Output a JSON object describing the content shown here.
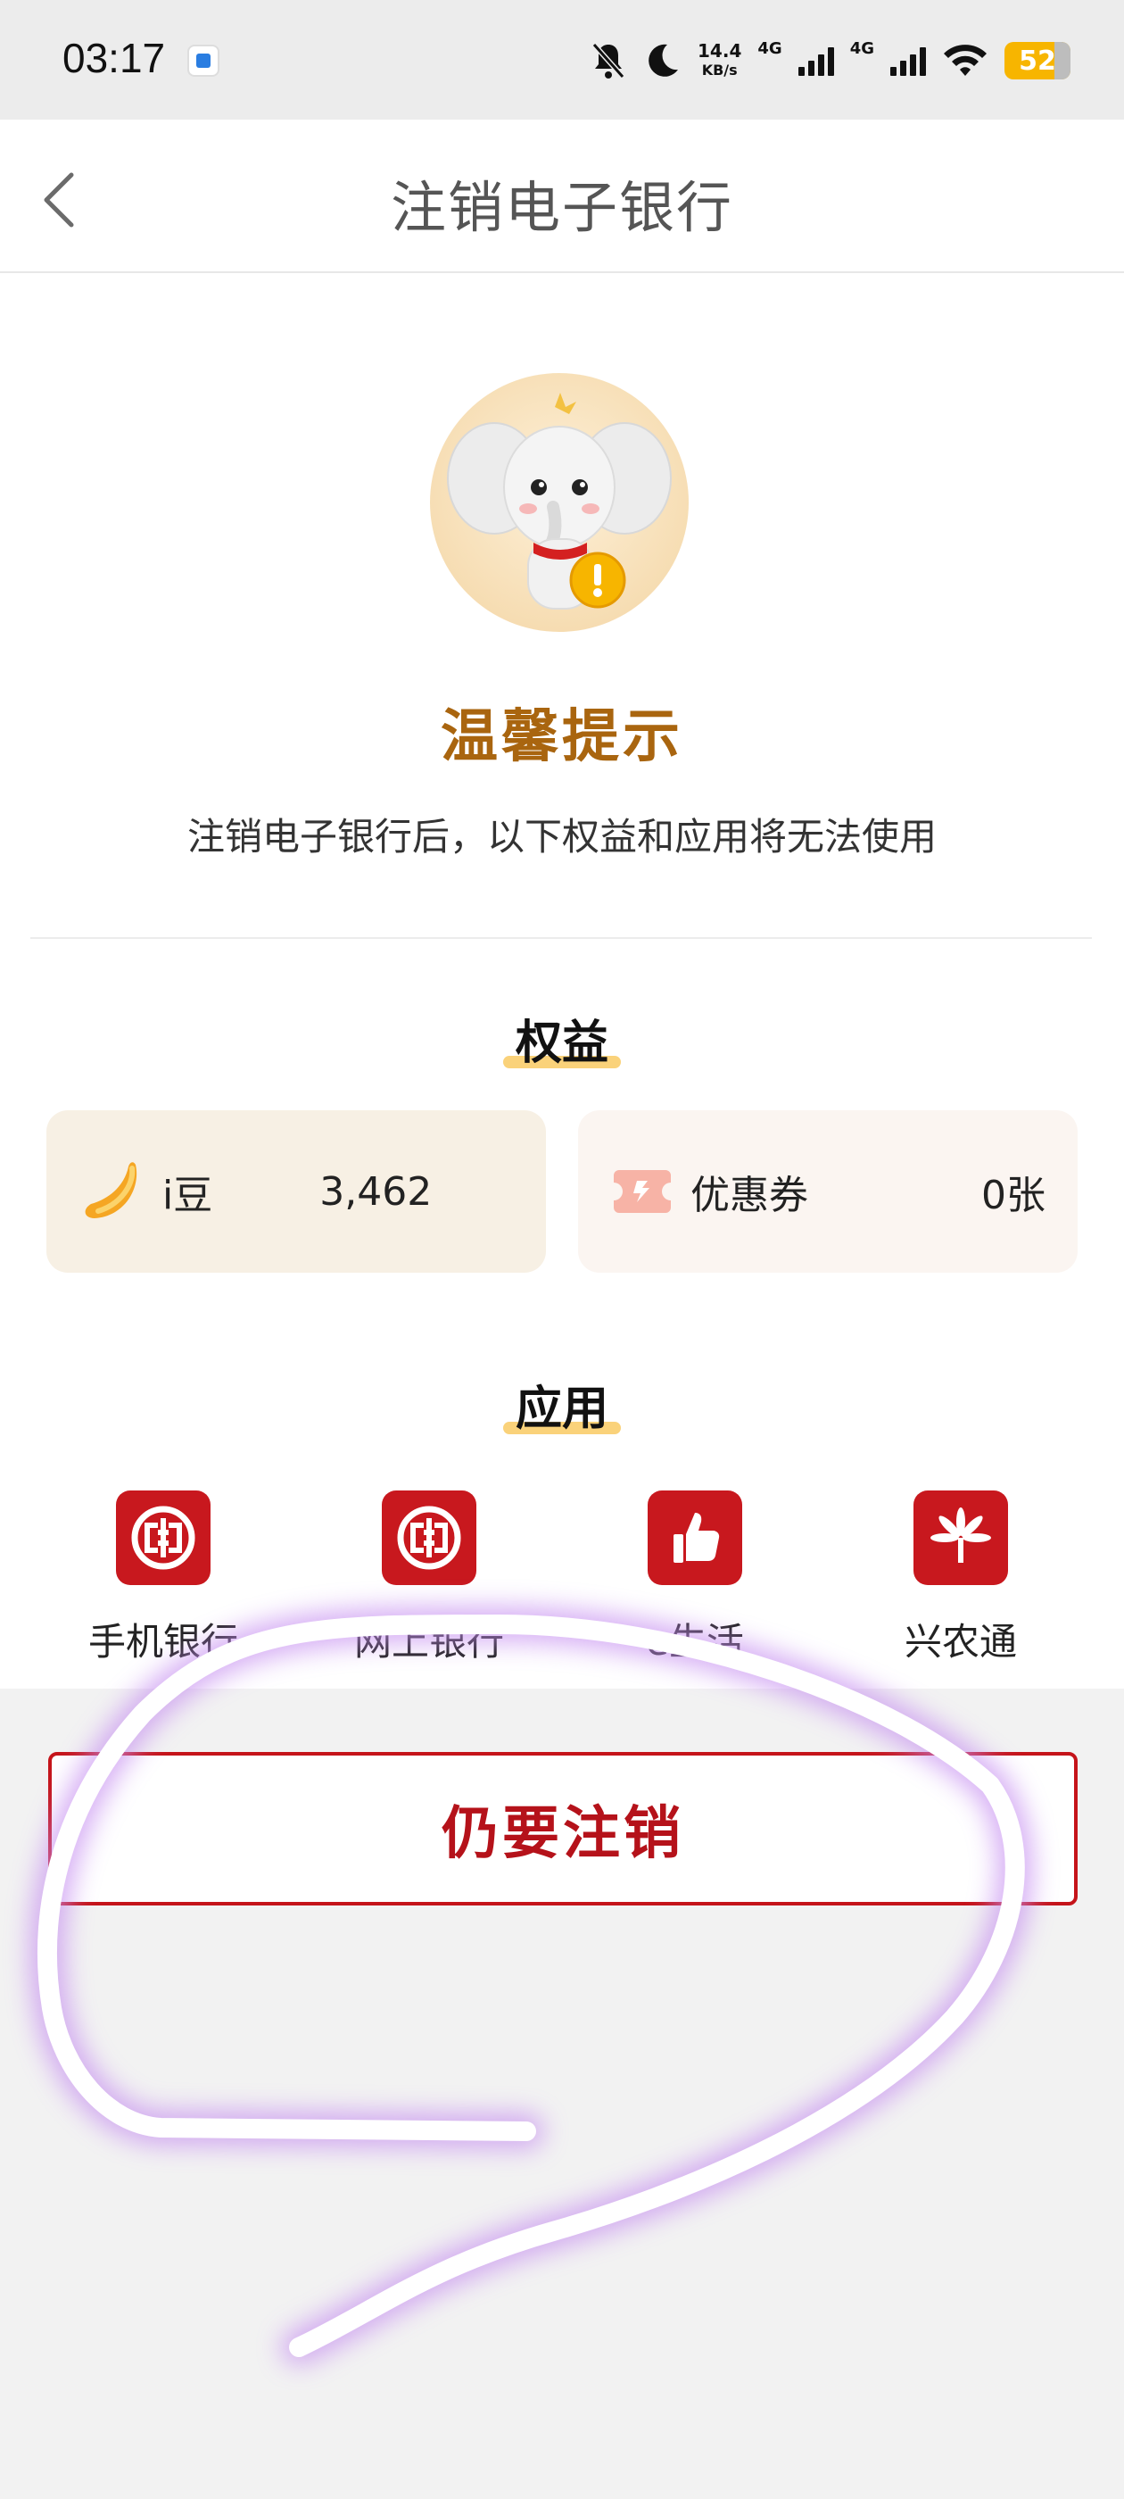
{
  "status_bar": {
    "time": "03:17",
    "network_speed_value": "14.4",
    "network_speed_unit": "KB/s",
    "sim1_label": "4G",
    "sim2_label": "4G",
    "battery_level": "52"
  },
  "header": {
    "title": "注销电子银行"
  },
  "notice": {
    "title": "温馨提示",
    "description": "注销电子银行后，以下权益和应用将无法使用"
  },
  "benefits": {
    "title": "权益",
    "items": [
      {
        "icon": "gold-bean-icon",
        "label": "i豆",
        "value": "3,462"
      },
      {
        "icon": "coupon-ticket-icon",
        "label": "优惠券",
        "value": "0张"
      }
    ]
  },
  "apps": {
    "title": "应用",
    "items": [
      {
        "icon": "icbc-logo-icon",
        "label": "手机银行"
      },
      {
        "icon": "icbc-logo-icon",
        "label": "网上银行"
      },
      {
        "icon": "thumbs-up-icon",
        "label": "e生活"
      },
      {
        "icon": "flower-logo-icon",
        "label": "兴农通"
      }
    ]
  },
  "actions": {
    "confirm_cancel_label": "仍要注销"
  },
  "colors": {
    "accent_red": "#c5141a",
    "notice_brown": "#a9650f",
    "highlight_yellow": "#fad27a",
    "scribble_glow": "#c58cf0"
  }
}
